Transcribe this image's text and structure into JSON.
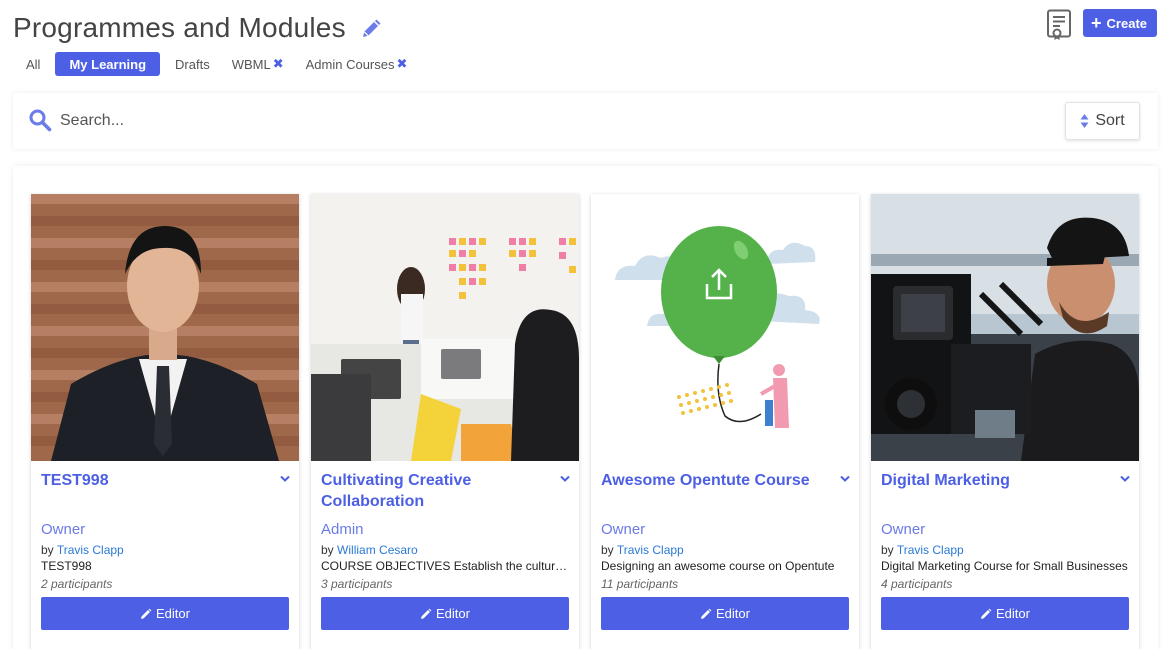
{
  "header": {
    "title": "Programmes and Modules",
    "create_label": "Create"
  },
  "tabs": [
    {
      "label": "All",
      "active": false,
      "removable": false
    },
    {
      "label": "My Learning",
      "active": true,
      "removable": false
    },
    {
      "label": "Drafts",
      "active": false,
      "removable": false
    },
    {
      "label": "WBML",
      "active": false,
      "removable": true
    },
    {
      "label": "Admin Courses",
      "active": false,
      "removable": true
    }
  ],
  "search": {
    "placeholder": "Search...",
    "value": ""
  },
  "sort": {
    "label": "Sort"
  },
  "cards": [
    {
      "title": "TEST998",
      "role": "Owner",
      "by_prefix": "by",
      "author": "Travis Clapp",
      "description": "TEST998",
      "participants": "2 participants",
      "button_label": "Editor",
      "image": "portrait-man-suit"
    },
    {
      "title": "Cultivating Creative Collaboration",
      "role": "Admin",
      "by_prefix": "by",
      "author": "William Cesaro",
      "description": "COURSE OBJECTIVES Establish the culture of collaboration",
      "participants": "3 participants",
      "button_label": "Editor",
      "image": "office-meeting-sticky-notes"
    },
    {
      "title": "Awesome Opentute Course",
      "role": "Owner",
      "by_prefix": "by",
      "author": "Travis Clapp",
      "description": "Designing an awesome course on Opentute",
      "participants": "11 participants",
      "button_label": "Editor",
      "image": "upload-balloon-illustration"
    },
    {
      "title": "Digital Marketing",
      "role": "Owner",
      "by_prefix": "by",
      "author": "Travis Clapp",
      "description": "Digital Marketing Course for Small Businesses",
      "participants": "4 participants",
      "button_label": "Editor",
      "image": "videographer-camera"
    }
  ],
  "colors": {
    "accent": "#4c5fe5",
    "link": "#2a7ad5",
    "role": "#6b7be8"
  }
}
